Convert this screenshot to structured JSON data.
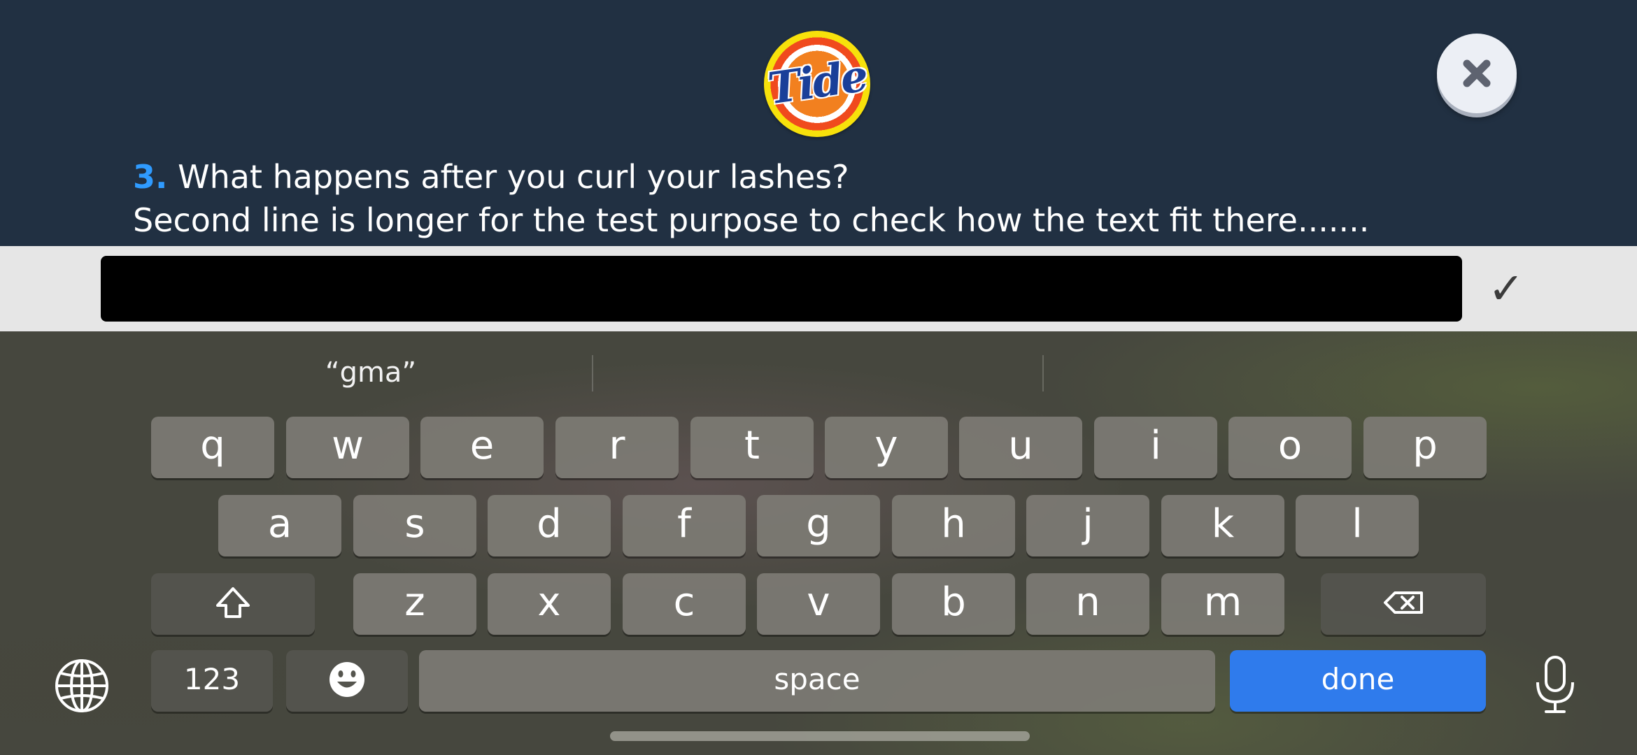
{
  "header": {
    "logo_text": "Tide",
    "question_number": "3.",
    "question_line1": "What happens after you curl your lashes?",
    "question_line2": "Second line is longer for the test purpose to check how the text fit there.......",
    "close_icon": "close-icon"
  },
  "answer": {
    "value": "",
    "placeholder": "",
    "submit_glyph": "✓"
  },
  "keyboard": {
    "suggestions": [
      "“gma”",
      "",
      ""
    ],
    "row1": [
      "q",
      "w",
      "e",
      "r",
      "t",
      "y",
      "u",
      "i",
      "o",
      "p"
    ],
    "row2": [
      "a",
      "s",
      "d",
      "f",
      "g",
      "h",
      "j",
      "k",
      "l"
    ],
    "row3": [
      "z",
      "x",
      "c",
      "v",
      "b",
      "n",
      "m"
    ],
    "numbers_label": "123",
    "space_label": "space",
    "done_label": "done",
    "icons": [
      "shift-icon",
      "delete-icon",
      "emoji-icon",
      "globe-icon",
      "microphone-icon"
    ],
    "accent_color": "#2f7bec"
  }
}
